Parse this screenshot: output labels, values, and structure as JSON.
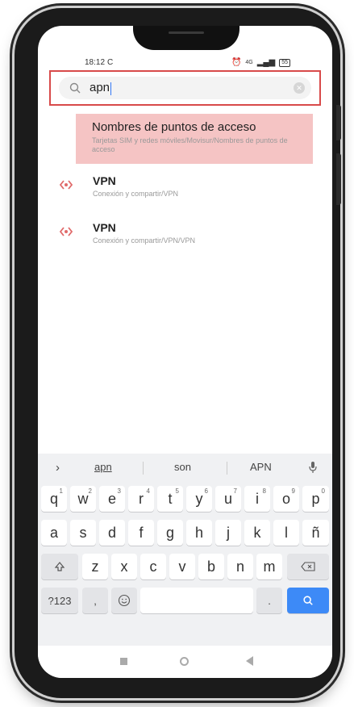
{
  "status_bar": {
    "time": "18:12",
    "time_icon": "C",
    "network": "4G",
    "battery": "55"
  },
  "search": {
    "query": "apn"
  },
  "results": [
    {
      "title": "Nombres de puntos de acceso",
      "subtitle": "Tarjetas SIM y redes móviles/Movisur/Nombres de puntos de acceso",
      "highlighted": true
    },
    {
      "title": "VPN",
      "subtitle": "Conexión y compartir/VPN",
      "icon": "vpn-icon"
    },
    {
      "title": "VPN",
      "subtitle": "Conexión y compartir/VPN/VPN",
      "icon": "vpn-icon"
    }
  ],
  "keyboard": {
    "suggestions": [
      "apn",
      "son",
      "APN"
    ],
    "row1": [
      "q",
      "w",
      "e",
      "r",
      "t",
      "y",
      "u",
      "i",
      "o",
      "p"
    ],
    "row1_alt": [
      "1",
      "2",
      "3",
      "4",
      "5",
      "6",
      "7",
      "8",
      "9",
      "0"
    ],
    "row2": [
      "a",
      "s",
      "d",
      "f",
      "g",
      "h",
      "j",
      "k",
      "l",
      "ñ"
    ],
    "row3": [
      "z",
      "x",
      "c",
      "v",
      "b",
      "n",
      "m"
    ],
    "symbols_label": "?123",
    "comma": ",",
    "period": "."
  },
  "colors": {
    "accent_red": "#d84a4a",
    "highlight_bg": "#f5c4c4",
    "keyboard_blue": "#3d8af7"
  }
}
